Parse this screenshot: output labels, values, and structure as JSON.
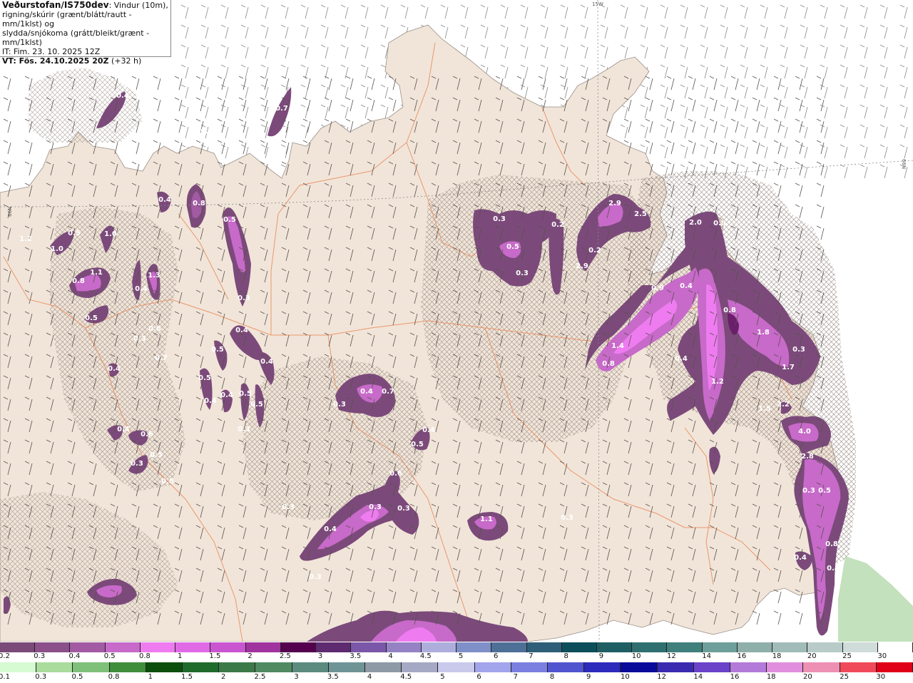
{
  "header": {
    "title": "Veðurstofan/IS750dev",
    "desc_line1": ": Vindur (10m),",
    "desc_line2": "rigning/skúrir (grænt/blátt/rautt - mm/1klst) og",
    "desc_line3": "slydda/snjókoma (grátt/bleikt/grænt - mm/1klst)",
    "it_line": "IT: Fim. 23. 10. 2025 12Z",
    "vt_label": "VT: Fös. 24.10.2025 20Z",
    "vt_offset": " (+32 h)"
  },
  "grid_labels": {
    "top": "15W",
    "left": "66N",
    "right": "66N"
  },
  "precip_values": [
    "0.4",
    "0.3",
    "0.7",
    "0.4",
    "0.8",
    "0.5",
    "0.5",
    "1.0",
    "1.2",
    "1.0",
    "0.8",
    "1.1",
    "1.3",
    "0.5",
    "0.4",
    "0.6",
    "0.3",
    "0.4",
    "0.7",
    "0.3",
    "0.4",
    "0.5",
    "0.4",
    "0.5",
    "0.4",
    "0.5",
    "0.4",
    "0.5",
    "0.3",
    "0.4",
    "0.6",
    "0.3",
    "0.5",
    "0.5",
    "0.3",
    "0.3",
    "0.3",
    "0.5",
    "0.3",
    "0.2",
    "0.2",
    "2.9",
    "2.9",
    "2.5",
    "2.0",
    "0.9",
    "0.9",
    "0.4",
    "0.8",
    "1.8",
    "1.4",
    "0.8",
    "0.4",
    "0.3",
    "1.7",
    "1.2",
    "2.2",
    "1.5",
    "4.0",
    "2.8",
    "0.3",
    "0.5",
    "0.8",
    "0.4",
    "0.4",
    "0.3",
    "0.4",
    "0.7",
    "0.4",
    "0.5",
    "0.6",
    "0.3",
    "0.3",
    "0.4",
    "1.1",
    "0.3"
  ],
  "legend_snow": {
    "labels": [
      "0.2",
      "0.3",
      "0.4",
      "0.5",
      "0.8",
      "1",
      "1.5",
      "2",
      "2.5",
      "3",
      "3.5",
      "4",
      "4.5",
      "5",
      "6",
      "7",
      "8",
      "9",
      "10",
      "12",
      "14",
      "16",
      "18",
      "20",
      "25",
      "30"
    ],
    "colors": [
      "#7a4a78",
      "#8b4f8a",
      "#a25aa3",
      "#c76ac9",
      "#ee7cf0",
      "#e06ae6",
      "#c955d0",
      "#a1339e",
      "#55004f",
      "#5e2a70",
      "#7a57a8",
      "#9582c4",
      "#aeaedd",
      "#7f8fc8",
      "#4e7097",
      "#2f5f78",
      "#0c4f5a",
      "#1f5f64",
      "#2f6f70",
      "#3f7f7c",
      "#6f9f9a",
      "#8fafaa",
      "#a1bcb8",
      "#b8cbc8",
      "#cfdcd9",
      "#ffffff"
    ]
  },
  "legend_rain": {
    "labels": [
      "0.1",
      "0.3",
      "0.5",
      "0.8",
      "1",
      "1.5",
      "2",
      "2.5",
      "3",
      "3.5",
      "4",
      "4.5",
      "5",
      "6",
      "7",
      "8",
      "9",
      "10",
      "12",
      "14",
      "16",
      "18",
      "20",
      "25",
      "30"
    ],
    "colors": [
      "#d6fad2",
      "#a9dc9d",
      "#7fc07a",
      "#3f8e3c",
      "#0c4f0c",
      "#1f6b2c",
      "#3b7a48",
      "#4f8a60",
      "#5b8b7e",
      "#6f9496",
      "#8e9aa6",
      "#a6a9c4",
      "#c9c9ec",
      "#a2a4ec",
      "#7a7fe0",
      "#5055cf",
      "#2d2bbb",
      "#0a0a9a",
      "#3a2ab0",
      "#6a43c9",
      "#b37ad9",
      "#e08fdc",
      "#ee8fb4",
      "#f04a5a",
      "#e00018"
    ]
  }
}
